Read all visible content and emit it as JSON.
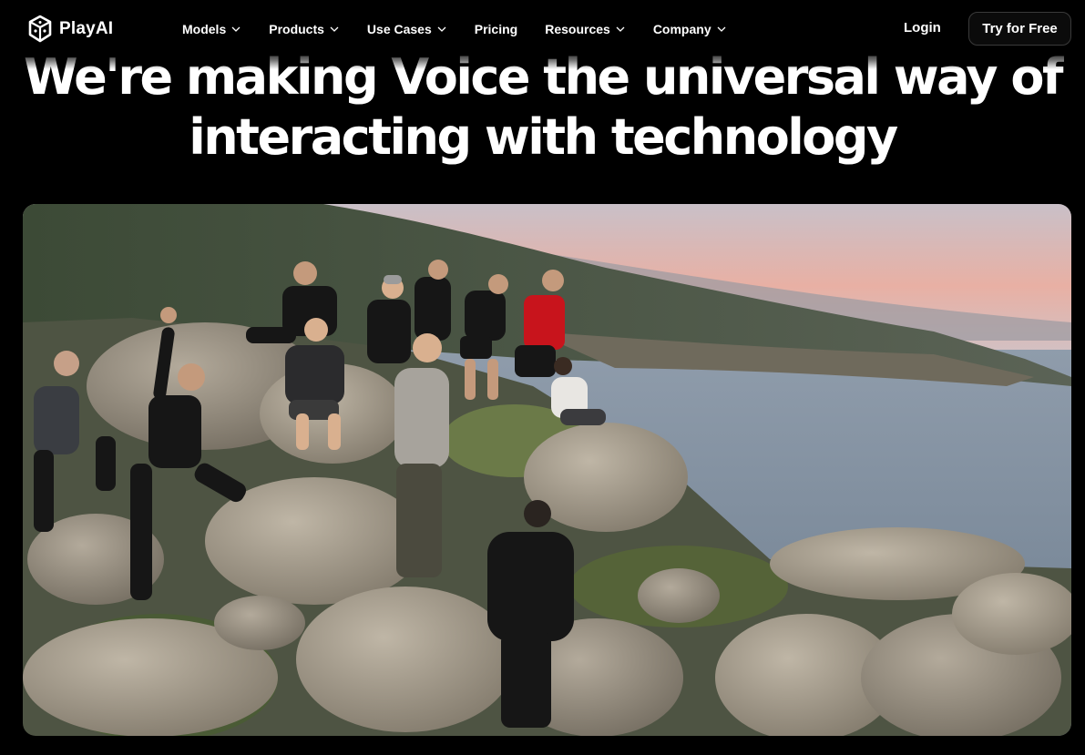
{
  "brand": {
    "name": "PlayAI",
    "logo_icon": "cube-logo-icon"
  },
  "nav": {
    "items": [
      {
        "label": "Models",
        "has_dropdown": true
      },
      {
        "label": "Products",
        "has_dropdown": true
      },
      {
        "label": "Use Cases",
        "has_dropdown": true
      },
      {
        "label": "Pricing",
        "has_dropdown": false
      },
      {
        "label": "Resources",
        "has_dropdown": true
      },
      {
        "label": "Company",
        "has_dropdown": true
      }
    ]
  },
  "auth": {
    "login_label": "Login",
    "cta_label": "Try for Free"
  },
  "hero": {
    "line1": "We're making Voice the universal way of",
    "line2": "interacting with technology"
  },
  "colors": {
    "background": "#000000",
    "text": "#ffffff",
    "button_border": "#3a3a3a"
  }
}
